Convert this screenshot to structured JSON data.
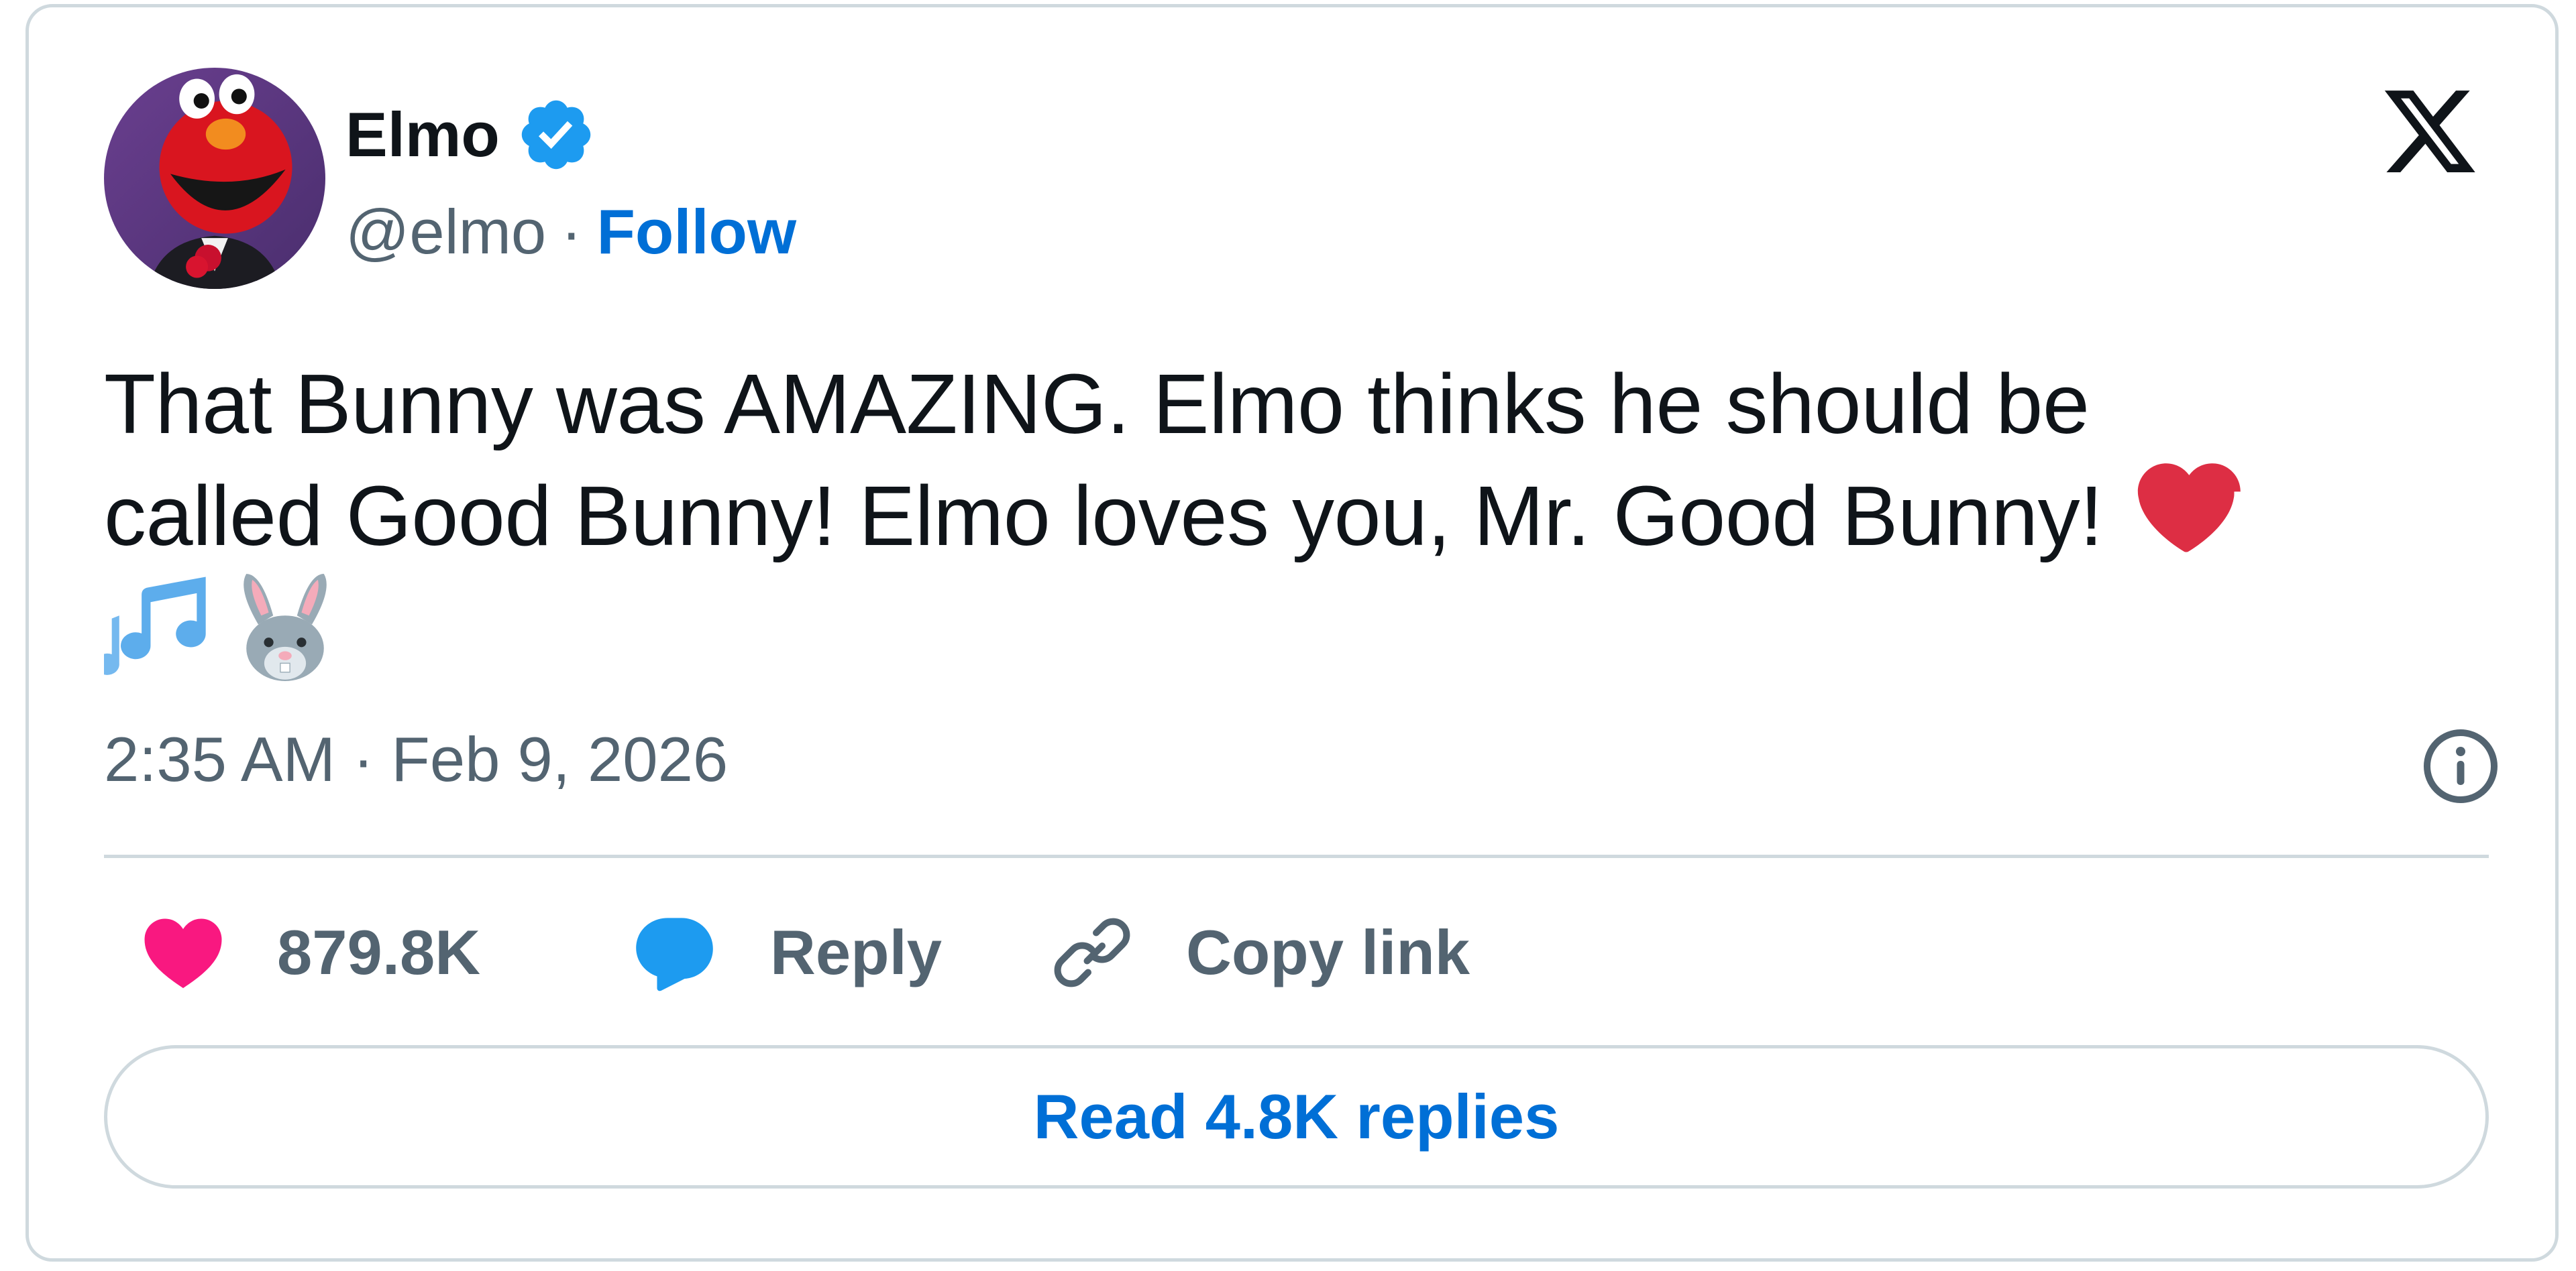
{
  "author": {
    "name": "Elmo",
    "handle": "@elmo",
    "separator": "·",
    "follow_label": "Follow",
    "verified": true,
    "avatar_icon": "elmo-avatar"
  },
  "brand": {
    "icon": "x-logo-icon"
  },
  "tweet": {
    "text_line1": "That Bunny was AMAZING. Elmo thinks he should be",
    "text_line2": "called Good Bunny! Elmo loves you, Mr. Good Bunny!",
    "emojis": [
      "red-heart",
      "musical-notes",
      "rabbit-face"
    ],
    "timestamp": "2:35 AM · Feb 9, 2026"
  },
  "actions": {
    "like_count": "879.8K",
    "reply_label": "Reply",
    "copy_link_label": "Copy link"
  },
  "footer": {
    "read_replies_label": "Read 4.8K replies"
  },
  "colors": {
    "accent_blue": "#006fd6",
    "verified_blue": "#1d9bf0",
    "like_pink": "#f91880",
    "reply_blue": "#1d9bf0",
    "heart_red": "#dd2e44",
    "secondary_text": "#536471",
    "border": "#cfd9de"
  }
}
